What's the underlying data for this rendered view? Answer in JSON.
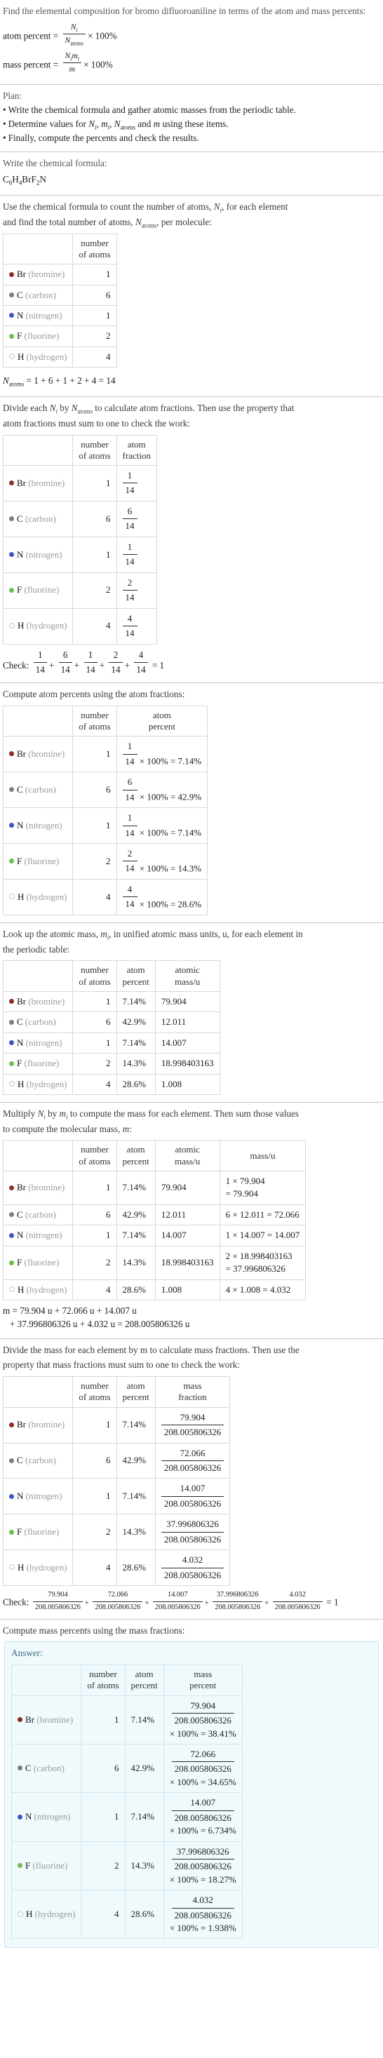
{
  "problem": {
    "statement": "Find the elemental composition for bromo difluoroaniline in terms of the atom and mass percents:",
    "atom_percent_label": "atom percent = ",
    "atom_percent_num": "N",
    "atom_percent_num_sub": "i",
    "atom_percent_den": "N",
    "atom_percent_den_sub": "atoms",
    "mass_percent_label": "mass percent = ",
    "mass_percent_num": "Nᵢmᵢ",
    "mass_percent_den": "m",
    "times_100": "× 100%"
  },
  "plan": {
    "title": "Plan:",
    "bullet_char": "•",
    "items": [
      "Write the chemical formula and gather atomic masses from the periodic table.",
      "Determine values for Nᵢ, mᵢ, Nₐₜₒₘₛ and m using these items.",
      "Finally, compute the percents and check the results."
    ]
  },
  "formula_section": {
    "lead": "Write the chemical formula:",
    "formula_parts": [
      {
        "sym": "C",
        "sub": "6"
      },
      {
        "sym": "H",
        "sub": "4"
      },
      {
        "sym": "Br",
        "sub": ""
      },
      {
        "sym": "F",
        "sub": "2"
      },
      {
        "sym": "N",
        "sub": ""
      }
    ]
  },
  "elements": [
    {
      "symbol": "Br",
      "name": "(bromine)",
      "color": "#8d2e21",
      "hollow": false,
      "count": "1",
      "fraction_num": "1",
      "fraction_den": "14",
      "atom_percent": "7.14%",
      "atomic_mass": "79.904",
      "mass_expr_line1": "1 × 79.904",
      "mass_expr_line2": "= 79.904",
      "mass_fraction_num": "79.904",
      "mass_fraction_den": "208.005806326",
      "mass_percent": "= 38.41%"
    },
    {
      "symbol": "C",
      "name": "(carbon)",
      "color": "#7c7c7c",
      "hollow": false,
      "count": "6",
      "fraction_num": "6",
      "fraction_den": "14",
      "atom_percent": "42.9%",
      "atomic_mass": "12.011",
      "mass_expr_line1": "6 × 12.011 = 72.066",
      "mass_expr_line2": "",
      "mass_fraction_num": "72.066",
      "mass_fraction_den": "208.005806326",
      "mass_percent": "= 34.65%"
    },
    {
      "symbol": "N",
      "name": "(nitrogen)",
      "color": "#3a56c4",
      "hollow": false,
      "count": "1",
      "fraction_num": "1",
      "fraction_den": "14",
      "atom_percent": "7.14%",
      "atomic_mass": "14.007",
      "mass_expr_line1": "1 × 14.007 = 14.007",
      "mass_expr_line2": "",
      "mass_fraction_num": "14.007",
      "mass_fraction_den": "208.005806326",
      "mass_percent": "= 6.734%"
    },
    {
      "symbol": "F",
      "name": "(fluorine)",
      "color": "#6bbf4a",
      "hollow": false,
      "count": "2",
      "fraction_num": "2",
      "fraction_den": "14",
      "atom_percent": "14.3%",
      "atomic_mass": "18.998403163",
      "mass_expr_line1": "2 × 18.998403163",
      "mass_expr_line2": "= 37.996806326",
      "mass_fraction_num": "37.996806326",
      "mass_fraction_den": "208.005806326",
      "mass_percent": "= 18.27%"
    },
    {
      "symbol": "H",
      "name": "(hydrogen)",
      "color": "#ffffff",
      "hollow": true,
      "count": "4",
      "fraction_num": "4",
      "fraction_den": "14",
      "atom_percent": "28.6%",
      "atomic_mass": "1.008",
      "mass_expr_line1": "4 × 1.008 = 4.032",
      "mass_expr_line2": "",
      "mass_fraction_num": "4.032",
      "mass_fraction_den": "208.005806326",
      "mass_percent": "= 1.938%"
    }
  ],
  "headers": {
    "number_of_atoms_l1": "number",
    "number_of_atoms_l2": "of atoms",
    "atom_fraction_l1": "atom",
    "atom_fraction_l2": "fraction",
    "atom_percent_l1": "atom",
    "atom_percent_l2": "percent",
    "atomic_mass_l1": "atomic",
    "atomic_mass_l2": "mass/u",
    "mass_u": "mass/u",
    "mass_fraction_l1": "mass",
    "mass_fraction_l2": "fraction",
    "mass_percent_l1": "mass",
    "mass_percent_l2": "percent"
  },
  "count_section": {
    "lead_line1": "Use the chemical formula to count the number of atoms, Nᵢ, for each element",
    "lead_line2": "and find the total number of atoms, Nₐₜₒₘₛ, per molecule:",
    "total_equation": "Nₐₜₒₘₛ = 1 + 6 + 1 + 2 + 4 = 14"
  },
  "fraction_section": {
    "lead_line1": "Divide each Nᵢ by Nₐₜₒₘₛ to calculate atom fractions. Then use the property that",
    "lead_line2": "atom fractions must sum to one to check the work:",
    "check_label": "Check:",
    "check_result": "= 1"
  },
  "atom_percent_section": {
    "lead": "Compute atom percents using the atom fractions:",
    "times_100": "× 100% ="
  },
  "atomic_mass_section": {
    "lead_line1": "Look up the atomic mass, mᵢ, in unified atomic mass units, u, for each element in",
    "lead_line2": "the periodic table:"
  },
  "mass_section": {
    "lead_line1": "Multiply Nᵢ by mᵢ to compute the mass for each element. Then sum those values",
    "lead_line2": "to compute the molecular mass, m:",
    "sum_line1": "m = 79.904 u + 72.066 u + 14.007 u",
    "sum_line2": "+ 37.996806326 u + 4.032 u = 208.005806326 u"
  },
  "mass_fraction_section": {
    "lead_line1": "Divide the mass for each element by m to calculate mass fractions. Then use the",
    "lead_line2": "property that mass fractions must sum to one to check the work:",
    "check_label": "Check:",
    "check_result": "= 1"
  },
  "final_section": {
    "lead": "Compute mass percents using the mass fractions:",
    "answer_label": "Answer:",
    "times_100": "× 100%"
  }
}
